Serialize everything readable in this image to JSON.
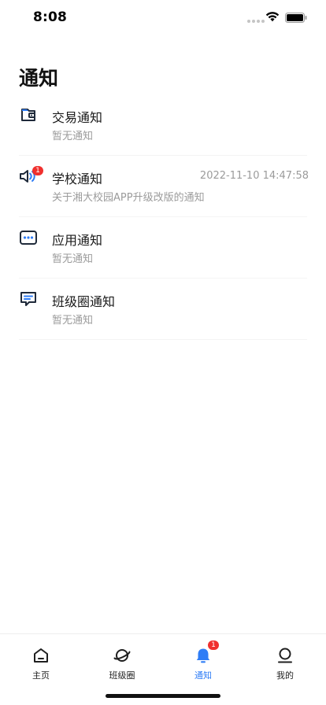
{
  "status_bar": {
    "time": "8:08"
  },
  "page": {
    "title": "通知"
  },
  "notices": [
    {
      "title": "交易通知",
      "subtitle": "暂无通知",
      "time": "",
      "badge": "",
      "icon": "wallet-icon"
    },
    {
      "title": "学校通知",
      "subtitle": "关于湘大校园APP升级改版的通知",
      "time": "2022-11-10 14:47:58",
      "badge": "1",
      "icon": "speaker-icon"
    },
    {
      "title": "应用通知",
      "subtitle": "暂无通知",
      "time": "",
      "badge": "",
      "icon": "app-dots-icon"
    },
    {
      "title": "班级圈通知",
      "subtitle": "暂无通知",
      "time": "",
      "badge": "",
      "icon": "message-icon"
    }
  ],
  "tab_bar": {
    "items": [
      {
        "label": "主页",
        "icon": "home-icon",
        "active": false
      },
      {
        "label": "班级圈",
        "icon": "planet-icon",
        "active": false
      },
      {
        "label": "通知",
        "icon": "bell-icon",
        "active": true,
        "badge": "1"
      },
      {
        "label": "我的",
        "icon": "user-icon",
        "active": false
      }
    ]
  },
  "colors": {
    "accent": "#2f7df6",
    "badge": "#f0302e",
    "icon_dark": "#1f2a3a"
  }
}
